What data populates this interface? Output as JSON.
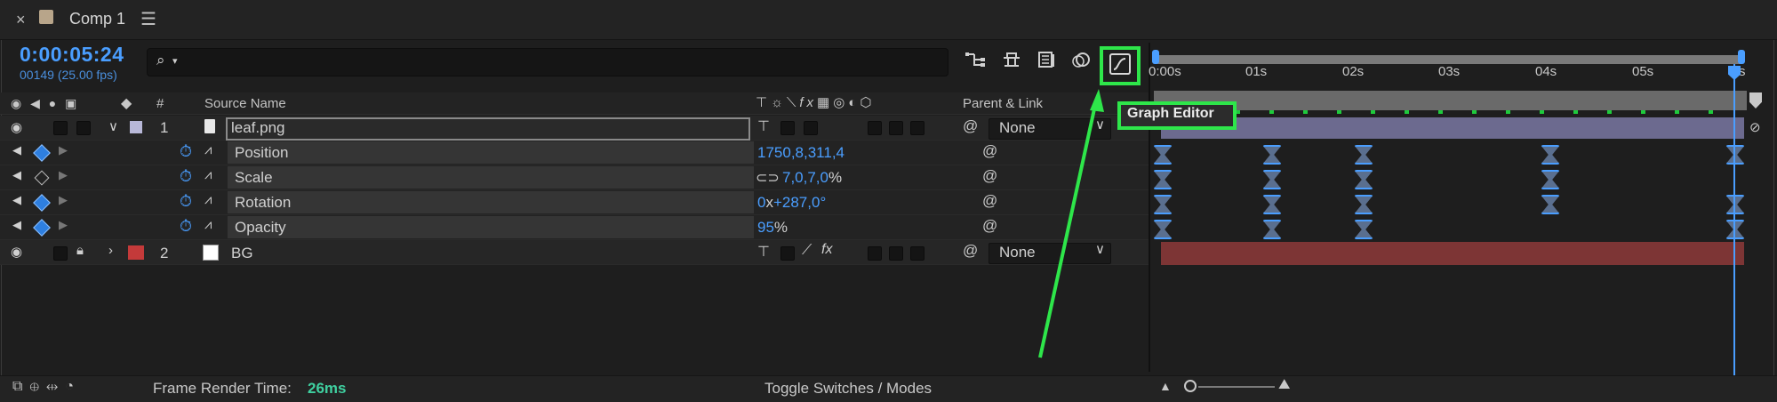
{
  "panel": {
    "title": "Comp 1",
    "close_glyph": "×",
    "menu_glyph": "☰",
    "timecode": "0:00:05:24",
    "frame_info": "00149 (25.00 fps)",
    "search_icon": "search-icon",
    "search_glyph": "⌕"
  },
  "columns": {
    "number": "#",
    "source_name": "Source Name",
    "parent_link": "Parent & Link"
  },
  "layers": [
    {
      "index": "1",
      "name": "leaf.png",
      "label_color": "#b8b8d8",
      "parent": "None"
    },
    {
      "index": "2",
      "name": "BG",
      "label_color": "#c43a3a",
      "parent": "None"
    }
  ],
  "properties": [
    {
      "name": "Position",
      "value": "1750,8,311,4",
      "value_suffix": ""
    },
    {
      "name": "Scale",
      "value": "7,0,7,0",
      "value_suffix": "%"
    },
    {
      "name": "Rotation",
      "value_prefix": "0",
      "value_mid": "x",
      "value": "+287,0",
      "value_suffix": "°"
    },
    {
      "name": "Opacity",
      "value": "95",
      "value_suffix": "%"
    }
  ],
  "timeline": {
    "ticks": [
      "0:00s",
      "01s",
      "02s",
      "03s",
      "04s",
      "05s",
      "s"
    ]
  },
  "tooltip": {
    "text": "Graph Editor"
  },
  "footer": {
    "render_label": "Frame Render Time:",
    "render_value": "26ms",
    "toggle_label": "Toggle Switches / Modes"
  },
  "colors": {
    "accent": "#4a9eff",
    "highlight": "#2ee64a",
    "render_value": "#3fd0a0"
  }
}
